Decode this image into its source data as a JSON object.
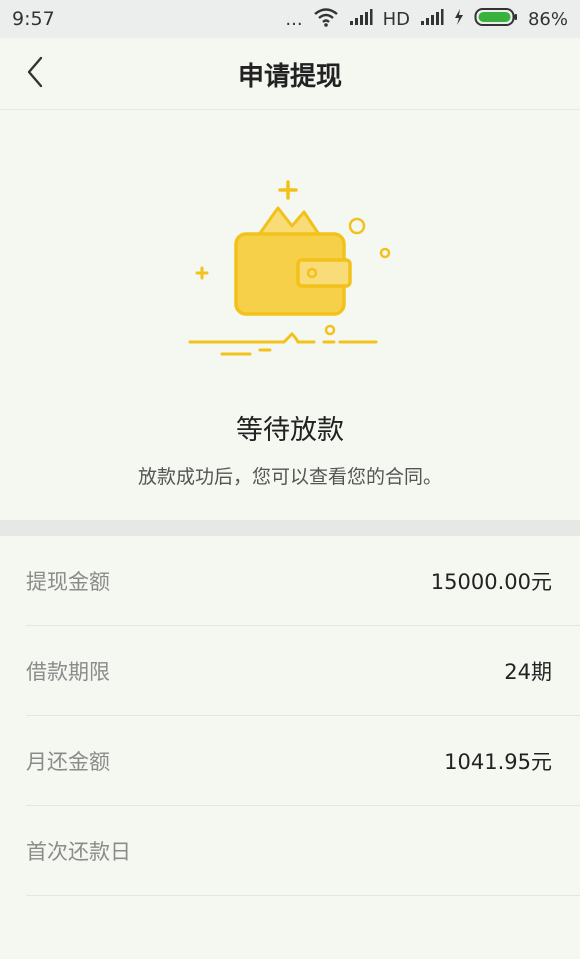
{
  "status_bar": {
    "time": "9:57",
    "dots": "...",
    "network": "HD",
    "battery": "86%",
    "icons": [
      "wifi-icon",
      "signal-icon",
      "charging-icon",
      "battery-icon"
    ]
  },
  "header": {
    "title": "申请提现",
    "back_icon": "chevron-left-icon"
  },
  "hero": {
    "icon": "wallet-icon",
    "accent_color": "#f2c21b",
    "title": "等待放款",
    "subtitle": "放款成功后，您可以查看您的合同。"
  },
  "details": [
    {
      "label": "提现金额",
      "value": "15000.00元"
    },
    {
      "label": "借款期限",
      "value": "24期"
    },
    {
      "label": "月还金额",
      "value": "1041.95元"
    },
    {
      "label": "首次还款日",
      "value": ""
    }
  ]
}
